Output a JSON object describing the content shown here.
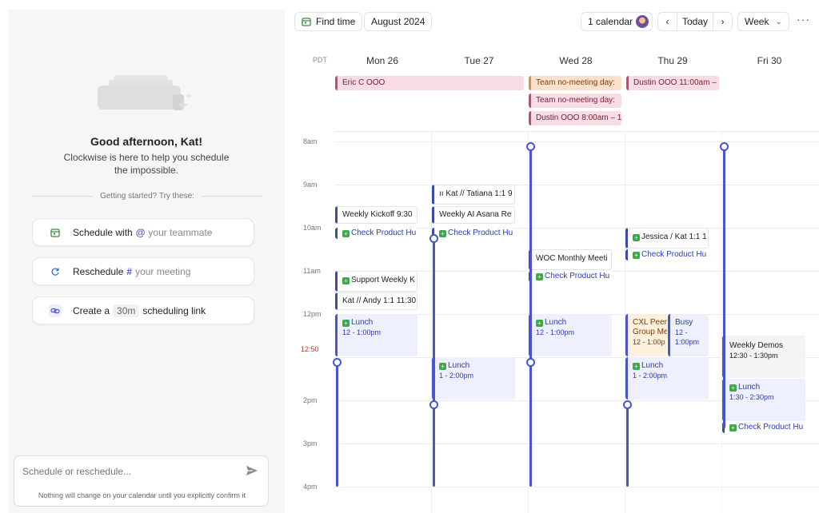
{
  "sidebar": {
    "greeting": "Good afternoon, Kat!",
    "subtitle": "Clockwise is here to help you schedule the impossible.",
    "getting_started": "Getting started? Try these:",
    "actions": [
      {
        "verb": "Schedule with",
        "symbol": "@",
        "placeholder": "your teammate"
      },
      {
        "verb": "Reschedule",
        "symbol": "#",
        "placeholder": "your meeting"
      },
      {
        "verb": "Create a",
        "chip": "30m",
        "suffix": "scheduling link"
      }
    ],
    "composer_placeholder": "Schedule or reschedule...",
    "composer_note": "Nothing will change on your calendar until you explicitly confirm it"
  },
  "toolbar": {
    "find_time": "Find time",
    "month": "August 2024",
    "calendars": "1 calendar",
    "prev": "‹",
    "today": "Today",
    "next": "›",
    "view": "Week",
    "view_caret": "⌄",
    "more": "···"
  },
  "calendar": {
    "timezone": "PDT",
    "days": [
      "Mon 26",
      "Tue 27",
      "Wed 28",
      "Thu 29",
      "Fri 30"
    ],
    "hours": [
      "8am",
      "9am",
      "10am",
      "11am",
      "12pm",
      "2pm",
      "3pm",
      "4pm"
    ],
    "now_label": "12:50",
    "all_day": {
      "eric": "Eric C OOO",
      "team1": "Team no-meeting day:",
      "team2": "Team no-meeting day:",
      "dustin_wed": "Dustin OOO 8:00am – 1",
      "dustin_thu": "Dustin OOO 11:00am –"
    },
    "events": {
      "mon_weekly_kickoff": "Weekly Kickoff  9:30",
      "mon_check": "Check Product Hu",
      "mon_support": "Support Weekly K",
      "mon_andy": "Kat // Andy 1:1  11:30",
      "mon_lunch": "Lunch",
      "mon_lunch_time": "12 - 1:00pm",
      "tue_tatiana": "ıı Kat // Tatiana 1:1  9",
      "tue_asana": "Weekly AI Asana Re",
      "tue_check": "Check Product Hu",
      "tue_lunch": "Lunch",
      "tue_lunch_time": "1 - 2:00pm",
      "wed_woc": "WOC Monthly Meeti",
      "wed_check": "Check Product Hu",
      "wed_lunch": "Lunch",
      "wed_lunch_time": "12 - 1:00pm",
      "thu_jessica": "Jessica / Kat 1:1  1",
      "thu_check": "Check Product Hu",
      "thu_cxl1": "CXL Peer",
      "thu_cxl2": "Group Me",
      "thu_cxl_time": "12 - 1:00p",
      "thu_busy": "Busy",
      "thu_busy_t1": "12 -",
      "thu_busy_t2": "1:00pm",
      "thu_lunch": "Lunch",
      "thu_lunch_time": "1 - 2:00pm",
      "fri_demos": "Weekly Demos",
      "fri_demos_time": "12:30 - 1:30pm",
      "fri_lunch": "Lunch",
      "fri_lunch_time": "1:30 - 2:30pm",
      "fri_check": "Check Product Hu"
    }
  },
  "colors": {
    "accent": "#4a53d1",
    "ooo": "#c9476a",
    "team_no_meeting": "#e88b3b",
    "now": "#c0392b"
  }
}
